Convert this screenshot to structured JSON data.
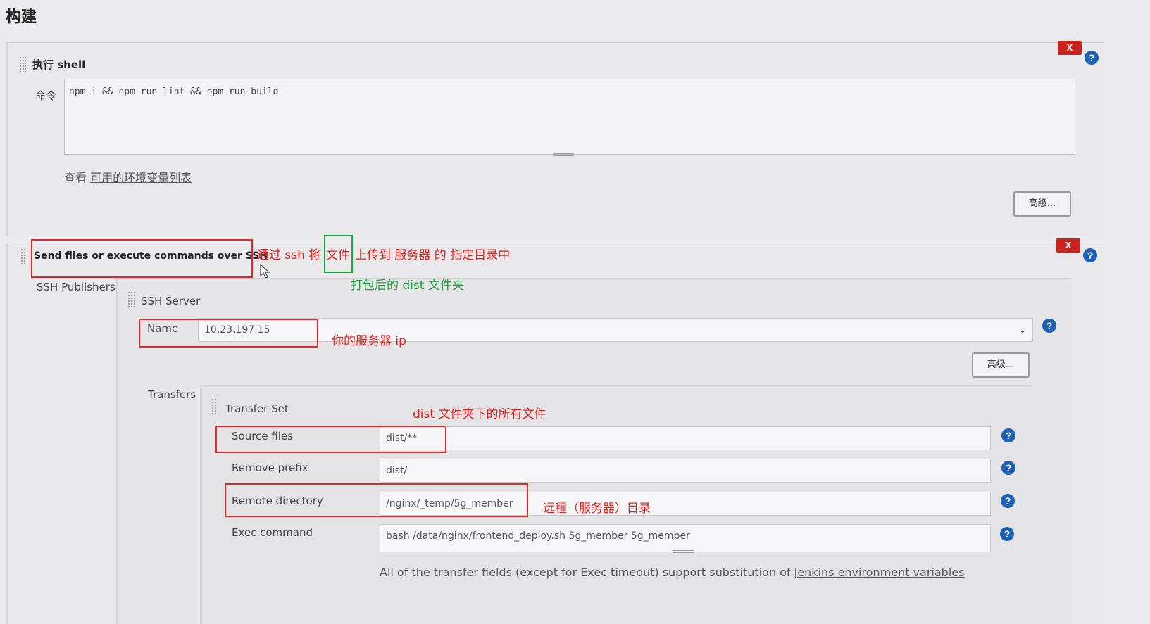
{
  "section_title": "构建",
  "shell_step": {
    "title": "执行 shell",
    "command_label": "命令",
    "command_value": "npm i && npm run lint && npm run build",
    "env_prefix": "查看",
    "env_link": "可用的环境变量列表",
    "advanced_label": "高级...",
    "delete_label": "X",
    "help_label": "?"
  },
  "ssh_step": {
    "title": "Send files or execute commands over SSH",
    "publishers_label": "SSH Publishers",
    "server_label": "SSH Server",
    "name_label": "Name",
    "name_value": "10.23.197.15",
    "advanced_label": "高级...",
    "delete_label": "X",
    "help_label": "?",
    "transfers_label": "Transfers",
    "transfer_set_label": "Transfer Set",
    "source_files_label": "Source files",
    "source_files_value": "dist/**",
    "remove_prefix_label": "Remove prefix",
    "remove_prefix_value": "dist/",
    "remote_directory_label": "Remote directory",
    "remote_directory_value": "/nginx/_temp/5g_member",
    "exec_command_label": "Exec command",
    "exec_command_value": "bash /data/nginx/frontend_deploy.sh 5g_member 5g_member",
    "note_text": "All of the transfer fields (except for Exec timeout) support substitution of",
    "note_link": "Jenkins environment variables"
  },
  "annotations": {
    "ssh_upload_a": "通过 ssh 将",
    "ssh_upload_files": "文件",
    "ssh_upload_b": "上传到 服务器 的 指定目录中",
    "dist_folder": "打包后的 dist 文件夹",
    "server_ip": "你的服务器 ip",
    "dist_all_files": "dist 文件夹下的所有文件",
    "remote_dir": "远程（服务器）目录"
  },
  "colors": {
    "annotation_red": "#e0201c",
    "annotation_green": "#1a9d3a",
    "delete_button": "#c9231f",
    "help_icon": "#1d5fb4"
  }
}
